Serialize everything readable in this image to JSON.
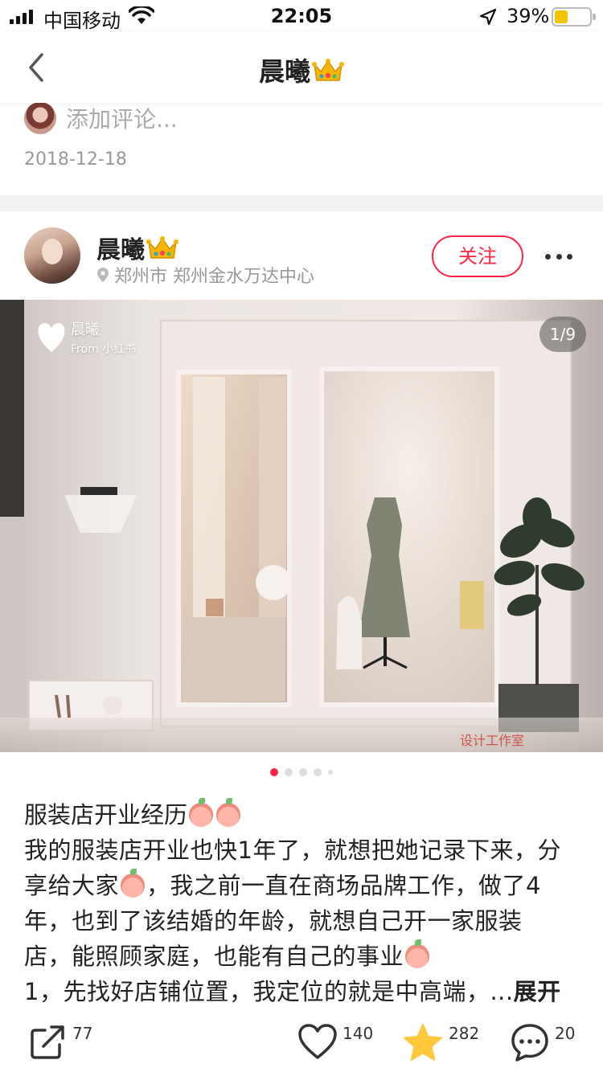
{
  "status_bar": {
    "carrier": "中国移动",
    "time": "22:05",
    "battery_text": "39%",
    "battery_level": 0.39,
    "battery_color": "#f5c400"
  },
  "nav": {
    "back_icon": "chevron-left-icon",
    "title": "晨曦"
  },
  "previous_post": {
    "add_comment_placeholder": "添加评论...",
    "date": "2018-12-18"
  },
  "post": {
    "author": {
      "name": "晨曦",
      "location": "郑州市 郑州金水万达中心"
    },
    "follow_label": "关注",
    "image": {
      "watermark_name": "晨曦",
      "watermark_from": "From 小红书",
      "page_counter": "1/9",
      "brand_watermark": "设计工作室"
    },
    "pagination": {
      "total": 5,
      "active_index": 0
    },
    "title": "服装店开业经历",
    "body_lines": [
      "我的服装店开业也快1年了，就想把她记录下来，分",
      "享给大家",
      "，我之前一直在商场品牌工作，做了4",
      "年，也到了该结婚的年龄，就想自己开一家服装",
      "店，能照顾家庭，也能有自己的事业",
      "1，先找好店铺位置，我定位的就是中高端，..."
    ],
    "expand_label": "展开",
    "actions": {
      "share_count": "77",
      "like_count": "140",
      "collect_count": "282",
      "comment_count": "20"
    },
    "accent_color": "#ff2442",
    "star_color": "#ffc83d"
  }
}
